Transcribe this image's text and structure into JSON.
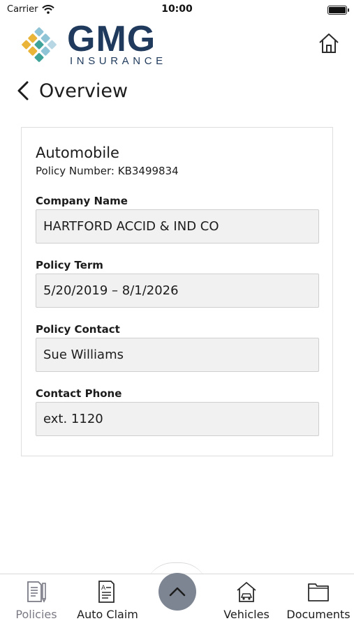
{
  "status_bar": {
    "carrier": "Carrier",
    "time": "10:00"
  },
  "brand": {
    "title": "GMG",
    "subtitle": "INSURANCE",
    "colors": [
      "#8fc3d6",
      "#e9b437",
      "#3fa39a",
      "#1f3a5c"
    ]
  },
  "header": {
    "title": "Overview",
    "back_icon": "chevron-left-icon",
    "home_icon": "home-icon"
  },
  "policy": {
    "type": "Automobile",
    "number_text": "Policy Number: KB3499834",
    "fields": [
      {
        "label": "Company Name",
        "value": "HARTFORD ACCID & IND CO"
      },
      {
        "label": "Policy Term",
        "value": "5/20/2019 – 8/1/2026"
      },
      {
        "label": "Policy Contact",
        "value": "Sue Williams"
      },
      {
        "label": "Contact Phone",
        "value": "ext. 1120"
      }
    ]
  },
  "tabs": [
    {
      "label": "Policies",
      "icon": "policies-icon",
      "active": true
    },
    {
      "label": "Auto Claim",
      "icon": "auto-claim-icon"
    },
    {
      "label": "Vehicles",
      "icon": "vehicles-icon"
    },
    {
      "label": "Documents",
      "icon": "documents-icon"
    }
  ],
  "center_button_icon": "chevron-up-icon",
  "colors": {
    "accent": "#1f3a5c",
    "field_bg": "#f1f1f2",
    "center_button": "#7d8592",
    "active_tab": "#7a7a85"
  }
}
